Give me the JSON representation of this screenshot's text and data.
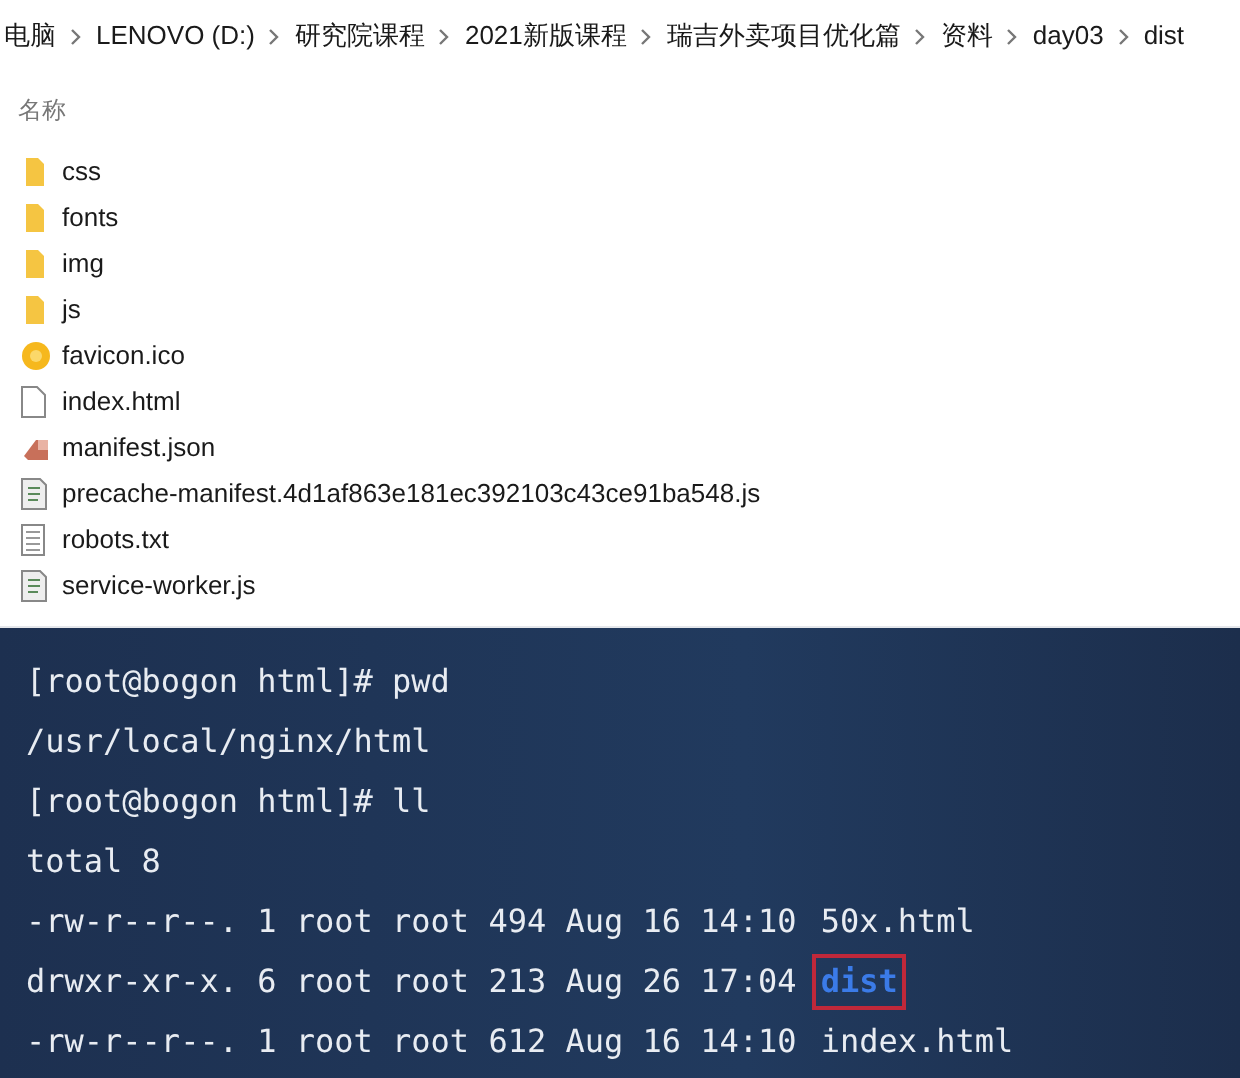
{
  "breadcrumb": [
    "电脑",
    "LENOVO (D:)",
    "研究院课程",
    "2021新版课程",
    "瑞吉外卖项目优化篇",
    "资料",
    "day03",
    "dist"
  ],
  "column_header": "名称",
  "files": [
    {
      "name": "css",
      "kind": "folder"
    },
    {
      "name": "fonts",
      "kind": "folder"
    },
    {
      "name": "img",
      "kind": "folder"
    },
    {
      "name": "js",
      "kind": "folder"
    },
    {
      "name": "favicon.ico",
      "kind": "ico"
    },
    {
      "name": "index.html",
      "kind": "blank"
    },
    {
      "name": "manifest.json",
      "kind": "json"
    },
    {
      "name": "precache-manifest.4d1af863e181ec392103c43ce91ba548.js",
      "kind": "script"
    },
    {
      "name": "robots.txt",
      "kind": "text"
    },
    {
      "name": "service-worker.js",
      "kind": "script"
    }
  ],
  "terminal": {
    "lines": [
      {
        "kind": "plain",
        "text": "[root@bogon html]# pwd"
      },
      {
        "kind": "plain",
        "text": "/usr/local/nginx/html"
      },
      {
        "kind": "plain",
        "text": "[root@bogon html]# ll"
      },
      {
        "kind": "plain",
        "text": "total 8"
      },
      {
        "kind": "listing",
        "text": "-rw-r--r--. 1 root root 494 Aug 16 14:10",
        "name": "50x.html",
        "directory": false,
        "marked": false
      },
      {
        "kind": "listing",
        "text": "drwxr-xr-x. 6 root root 213 Aug 26 17:04",
        "name": "dist",
        "directory": true,
        "marked": true
      },
      {
        "kind": "listing",
        "text": "-rw-r--r--. 1 root root 612 Aug 16 14:10",
        "name": "index.html",
        "directory": false,
        "marked": false
      }
    ]
  }
}
